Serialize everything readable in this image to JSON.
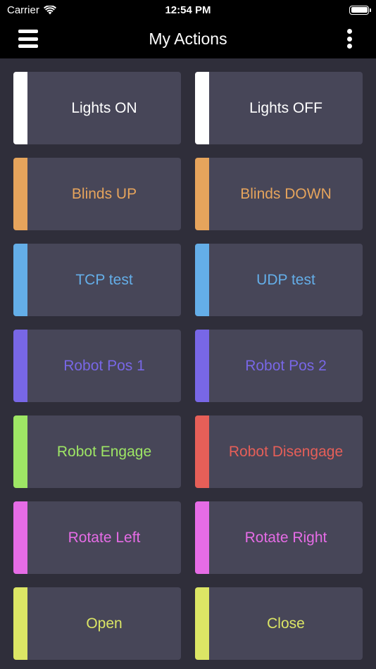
{
  "status_bar": {
    "carrier": "Carrier",
    "time": "12:54 PM"
  },
  "nav": {
    "title": "My Actions",
    "menu_icon": "hamburger-menu-icon",
    "more_icon": "more-vertical-icon"
  },
  "actions": [
    {
      "label": "Lights ON",
      "color": "#ffffff",
      "text_color": "#ffffff"
    },
    {
      "label": "Lights OFF",
      "color": "#ffffff",
      "text_color": "#ffffff"
    },
    {
      "label": "Blinds UP",
      "color": "#e6a45c",
      "text_color": "#e6a45c"
    },
    {
      "label": "Blinds DOWN",
      "color": "#e6a45c",
      "text_color": "#e6a45c"
    },
    {
      "label": "TCP test",
      "color": "#64aee8",
      "text_color": "#64aee8"
    },
    {
      "label": "UDP test",
      "color": "#64aee8",
      "text_color": "#64aee8"
    },
    {
      "label": "Robot Pos 1",
      "color": "#7867e6",
      "text_color": "#7867e6"
    },
    {
      "label": "Robot Pos 2",
      "color": "#7867e6",
      "text_color": "#7867e6"
    },
    {
      "label": "Robot Engage",
      "color": "#9ee665",
      "text_color": "#9ee665"
    },
    {
      "label": "Robot Disengage",
      "color": "#e65f58",
      "text_color": "#e65f58"
    },
    {
      "label": "Rotate Left",
      "color": "#e66ce6",
      "text_color": "#e66ce6"
    },
    {
      "label": "Rotate Right",
      "color": "#e66ce6",
      "text_color": "#e66ce6"
    },
    {
      "label": "Open",
      "color": "#dce665",
      "text_color": "#dce665"
    },
    {
      "label": "Close",
      "color": "#dce665",
      "text_color": "#dce665"
    }
  ]
}
